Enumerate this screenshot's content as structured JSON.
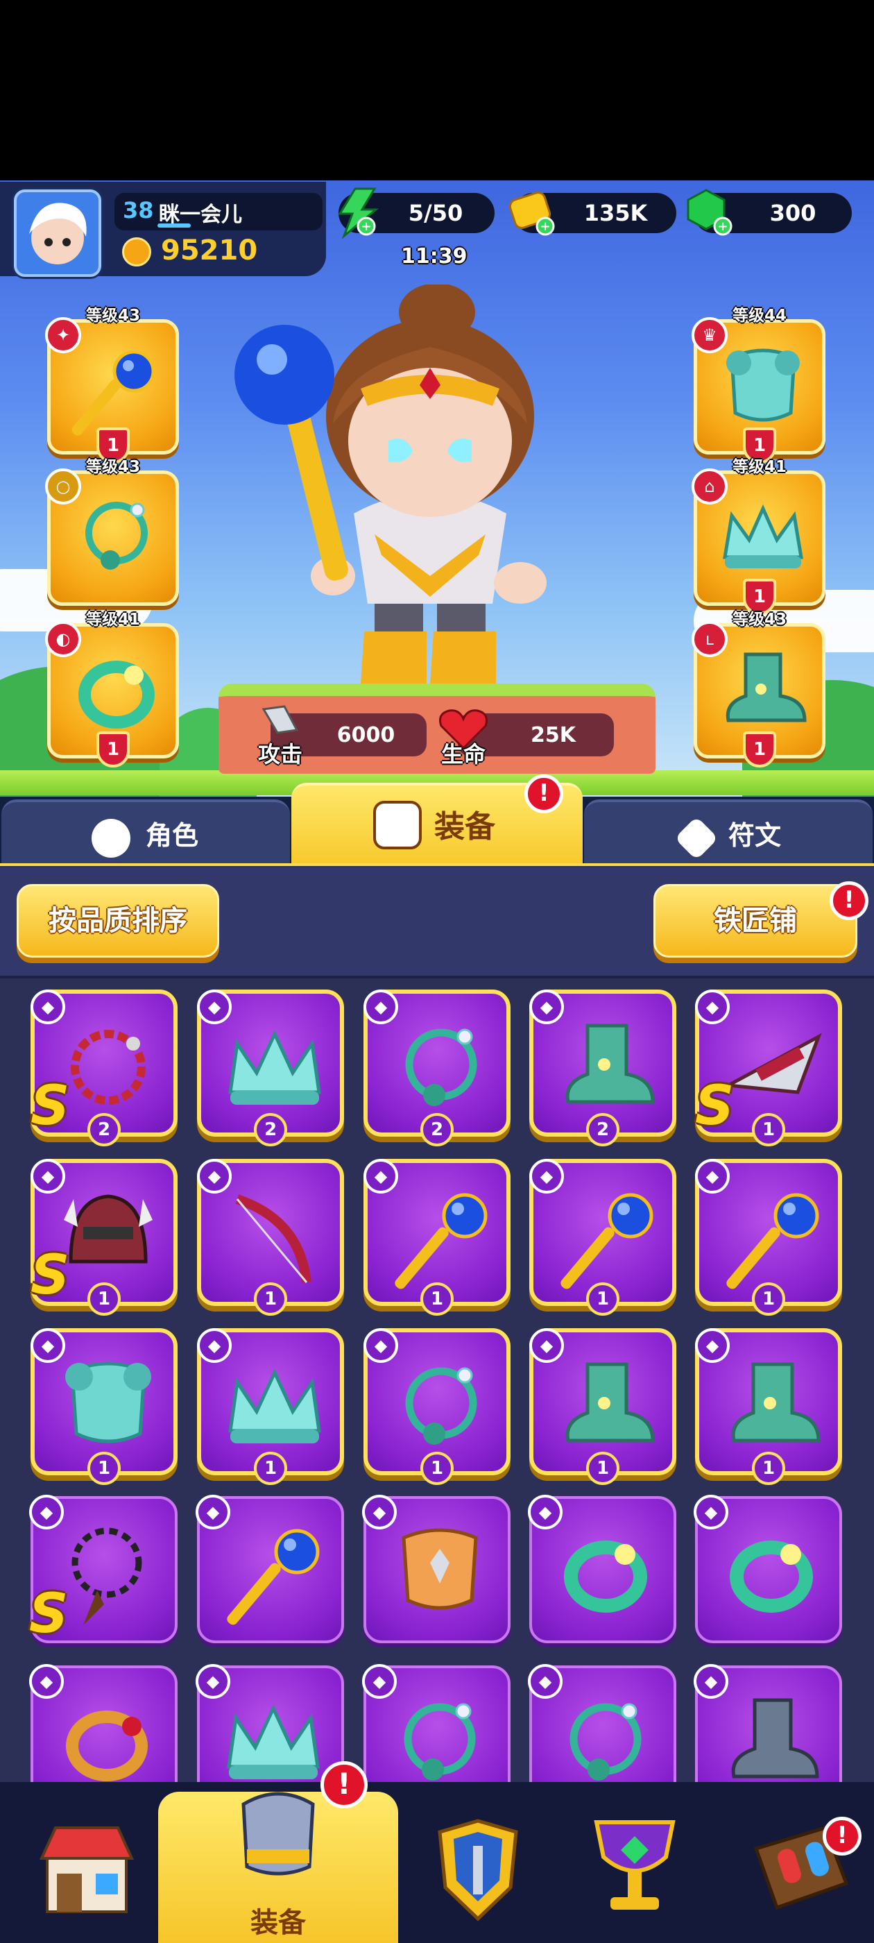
{
  "player": {
    "level": "38",
    "name": "眯一会儿",
    "power": "95210"
  },
  "resources": {
    "energy": "5/50",
    "gold": "135K",
    "gems": "300"
  },
  "timer": "11:39",
  "hero_stats": {
    "attack_label": "攻击",
    "attack_value": "6000",
    "hp_label": "生命",
    "hp_value": "25K"
  },
  "equipped": [
    {
      "level": "等级43",
      "count": "1",
      "icon": "scepter-icon"
    },
    {
      "level": "等级43",
      "count": "",
      "icon": "necklace-icon"
    },
    {
      "level": "等级41",
      "count": "1",
      "icon": "ring-icon"
    },
    {
      "level": "等级44",
      "count": "1",
      "icon": "armor-icon"
    },
    {
      "level": "等级41",
      "count": "1",
      "icon": "crown-icon"
    },
    {
      "level": "等级43",
      "count": "1",
      "icon": "boots-icon"
    }
  ],
  "tabs": [
    {
      "label": "角色"
    },
    {
      "label": "装备"
    },
    {
      "label": "符文"
    }
  ],
  "toolbar": {
    "sort_label": "按品质排序",
    "smith_label": "铁匠铺"
  },
  "inventory": [
    {
      "icon": "chain-necklace-icon",
      "count": "2",
      "s": "S"
    },
    {
      "icon": "crown-icon",
      "count": "2",
      "s": ""
    },
    {
      "icon": "necklace-icon",
      "count": "2",
      "s": ""
    },
    {
      "icon": "boots-icon",
      "count": "2",
      "s": ""
    },
    {
      "icon": "crossbow-icon",
      "count": "1",
      "s": "S"
    },
    {
      "icon": "helmet-icon",
      "count": "1",
      "s": "S"
    },
    {
      "icon": "bow-icon",
      "count": "1",
      "s": ""
    },
    {
      "icon": "scepter-icon",
      "count": "1",
      "s": ""
    },
    {
      "icon": "scepter-icon",
      "count": "1",
      "s": ""
    },
    {
      "icon": "scepter-icon",
      "count": "1",
      "s": ""
    },
    {
      "icon": "armor-icon",
      "count": "1",
      "s": ""
    },
    {
      "icon": "crown-icon",
      "count": "1",
      "s": ""
    },
    {
      "icon": "necklace-icon",
      "count": "1",
      "s": ""
    },
    {
      "icon": "boots-icon",
      "count": "1",
      "s": ""
    },
    {
      "icon": "boots-icon",
      "count": "1",
      "s": ""
    },
    {
      "icon": "feather-necklace-icon",
      "count": "",
      "s": "S"
    },
    {
      "icon": "scepter-icon",
      "count": "",
      "s": ""
    },
    {
      "icon": "chest-armor-icon",
      "count": "",
      "s": ""
    },
    {
      "icon": "ring-icon",
      "count": "",
      "s": ""
    },
    {
      "icon": "ring-icon",
      "count": "",
      "s": ""
    },
    {
      "icon": "gold-ring-icon",
      "count": "",
      "s": ""
    },
    {
      "icon": "crown-icon",
      "count": "",
      "s": ""
    },
    {
      "icon": "necklace-icon",
      "count": "",
      "s": ""
    },
    {
      "icon": "necklace-icon",
      "count": "",
      "s": ""
    },
    {
      "icon": "iron-boots-icon",
      "count": "",
      "s": ""
    }
  ],
  "bottom_nav": [
    {
      "icon": "shop-icon",
      "label": ""
    },
    {
      "icon": "armor-icon",
      "label": "装备"
    },
    {
      "icon": "shield-icon",
      "label": ""
    },
    {
      "icon": "trophy-icon",
      "label": ""
    },
    {
      "icon": "board-icon",
      "label": ""
    }
  ],
  "badge_text": "!",
  "colors": {
    "accent": "#f7c92b",
    "card": "#8a23d1",
    "alert": "#e0132b"
  }
}
